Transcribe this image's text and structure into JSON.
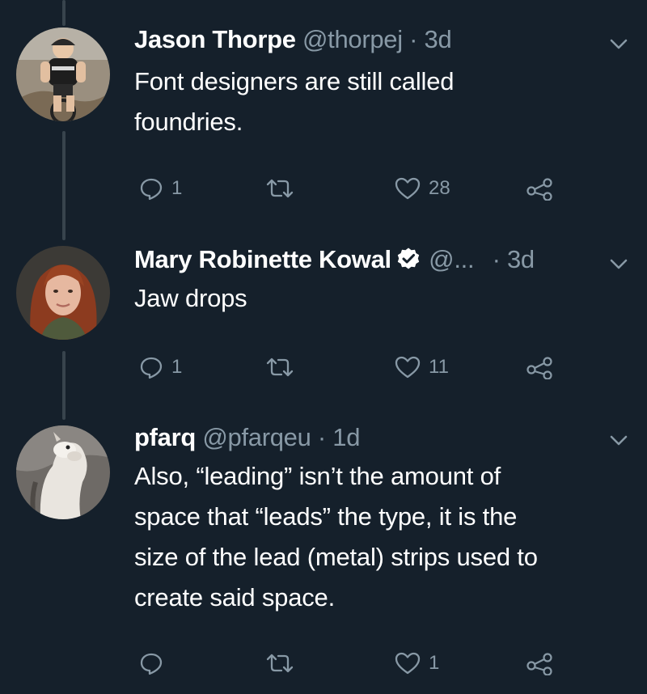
{
  "tweets": [
    {
      "name": "Jason Thorpe",
      "handle": "@thorpej",
      "separator": "·",
      "time": "3d",
      "text_lines": [
        "Font designers are still called",
        "foundries."
      ],
      "reply_count": "1",
      "retweet_count": "",
      "like_count": "28"
    },
    {
      "name": "Mary Robinette Kowal",
      "verified": true,
      "handle": "@...",
      "separator": "·",
      "time": "3d",
      "text_lines": [
        "Jaw drops"
      ],
      "reply_count": "1",
      "retweet_count": "",
      "like_count": "11"
    },
    {
      "name": "pfarq",
      "handle": "@pfarqeu",
      "separator": "·",
      "time": "1d",
      "text_lines": [
        "Also, “leading” isn’t the amount of",
        "space that “leads” the type, it is the",
        "size of the lead (metal) strips used to",
        "create said space."
      ],
      "reply_count": "",
      "retweet_count": "",
      "like_count": "1"
    }
  ],
  "colors": {
    "background": "#15202b",
    "primary_text": "#ffffff",
    "secondary_text": "#8899a6",
    "thread_line": "#38444d",
    "verified_badge": "#ffffff"
  },
  "icons": {
    "reply": "speech-bubble-icon",
    "retweet": "retweet-arrows-icon",
    "like": "heart-icon",
    "share": "share-nodes-icon",
    "menu": "chevron-down-icon",
    "verified": "verified-badge-icon"
  }
}
